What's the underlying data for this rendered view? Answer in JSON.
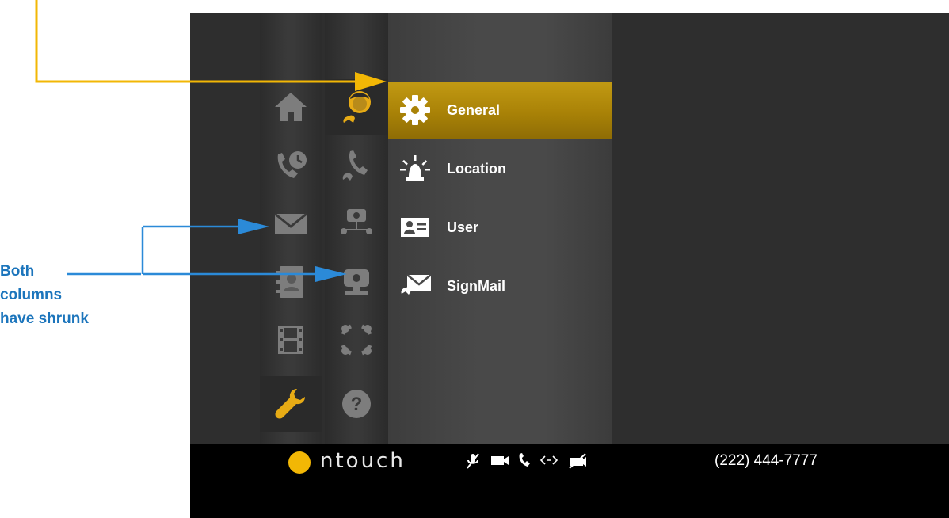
{
  "left_column": {
    "items": [
      {
        "name": "home-icon",
        "selected": false
      },
      {
        "name": "call-history-icon",
        "selected": false
      },
      {
        "name": "signmail-icon",
        "selected": false
      },
      {
        "name": "contacts-icon",
        "selected": false
      },
      {
        "name": "video-center-icon",
        "selected": false
      },
      {
        "name": "settings-wrench-icon",
        "selected": true
      }
    ]
  },
  "second_column": {
    "items": [
      {
        "name": "personal-settings-icon",
        "selected": true
      },
      {
        "name": "call-settings-icon",
        "selected": false
      },
      {
        "name": "network-settings-icon",
        "selected": false
      },
      {
        "name": "camera-settings-icon",
        "selected": false
      },
      {
        "name": "sync-icon",
        "selected": false
      },
      {
        "name": "help-icon",
        "selected": false
      }
    ]
  },
  "menu": {
    "items": [
      {
        "label": "General",
        "icon": "gear-icon",
        "active": true
      },
      {
        "label": "Location",
        "icon": "alert-light-icon",
        "active": false
      },
      {
        "label": "User",
        "icon": "user-card-icon",
        "active": false
      },
      {
        "label": "SignMail",
        "icon": "signmail-settings-icon",
        "active": false
      }
    ]
  },
  "status_bar": {
    "logo_text": "ntouch",
    "phone_number": "(222) 444-7777",
    "icons": [
      "mic-muted-icon",
      "video-camera-icon",
      "phone-icon",
      "connection-icon",
      "no-video-icon"
    ]
  },
  "annotation": {
    "line1": "Both",
    "line2": "columns",
    "line3": "have shrunk"
  },
  "colors": {
    "accent_gold": "#a98207",
    "annotation_blue": "#1c75bc",
    "arrow_orange": "#f2b705",
    "icon_gray": "#7d7d7d",
    "icon_selected": "#e7ab15"
  }
}
